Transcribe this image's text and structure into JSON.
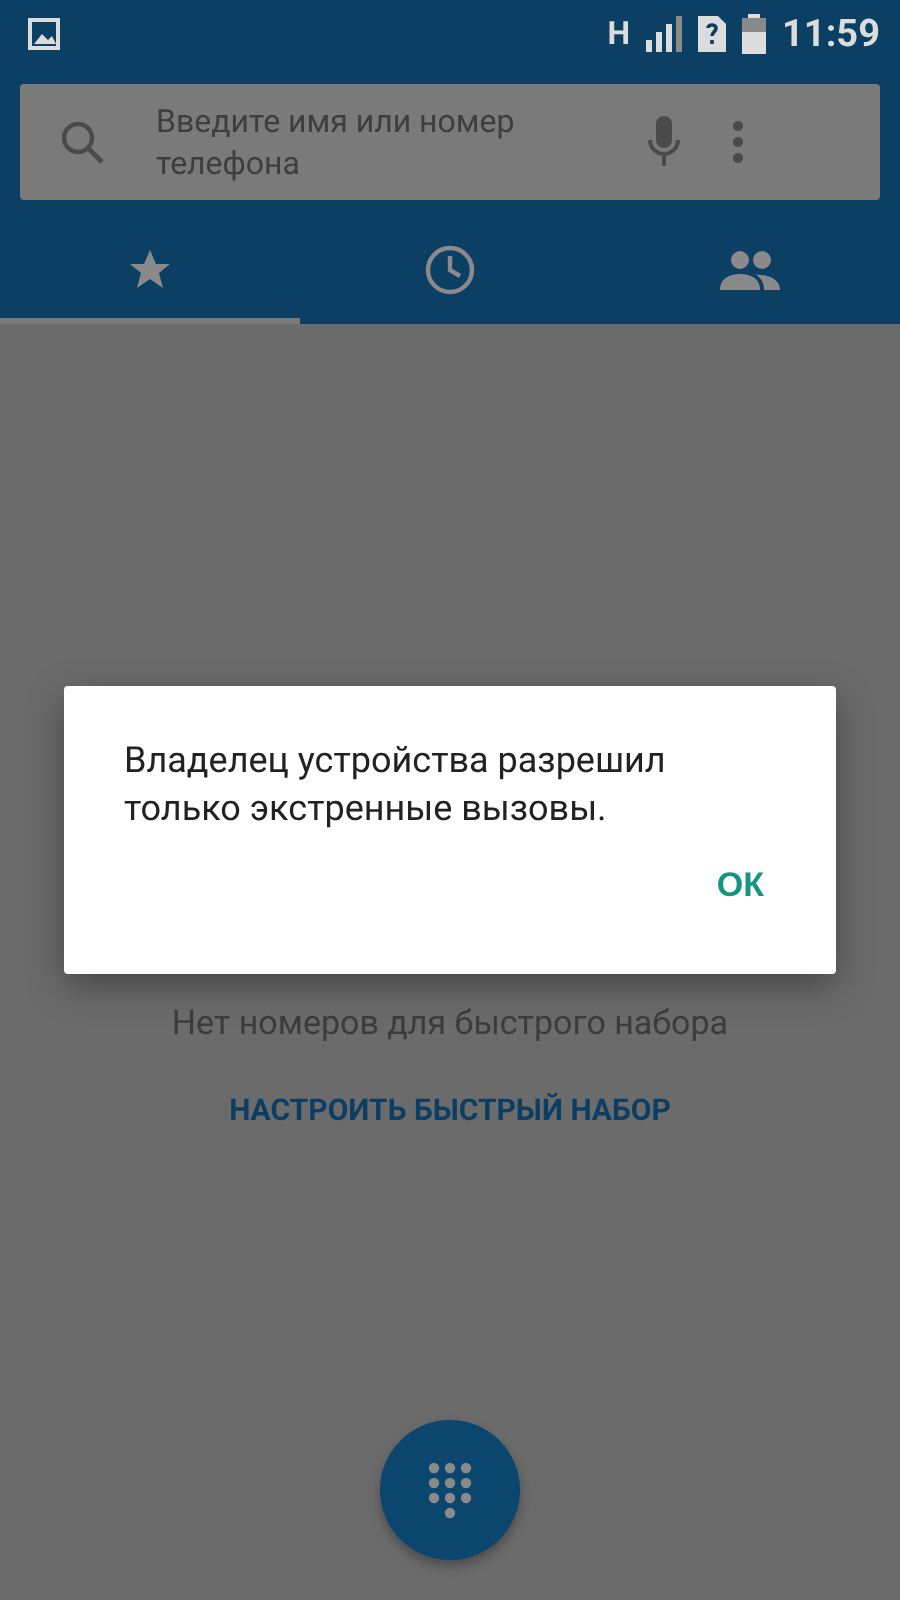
{
  "status_bar": {
    "network": "H",
    "time": "11:59"
  },
  "search": {
    "placeholder": "Введите имя или номер телефона"
  },
  "tabs": [
    {
      "kind": "star",
      "selected": true
    },
    {
      "kind": "clock",
      "selected": false
    },
    {
      "kind": "people",
      "selected": false
    }
  ],
  "empty_text": "Нет номеров для быстрого набора",
  "setup_link": "НАСТРОИТЬ БЫСТРЫЙ НАБОР",
  "dialog": {
    "message": "Владелец устройства разрешил только экстренные вызовы.",
    "button": "ОК"
  }
}
